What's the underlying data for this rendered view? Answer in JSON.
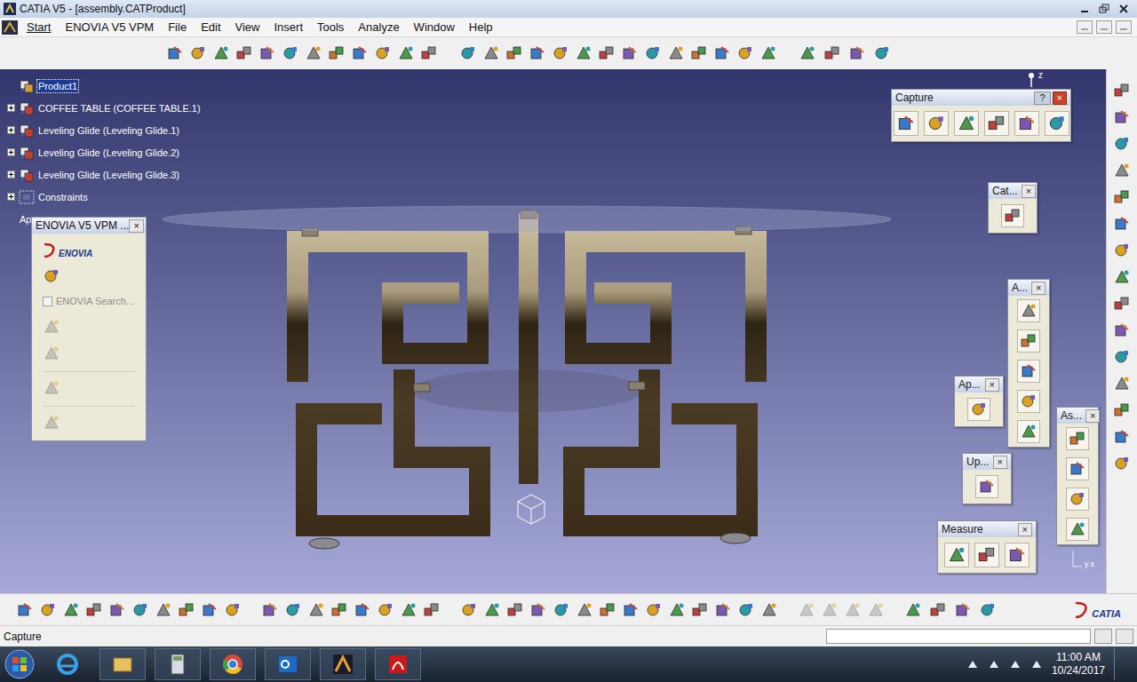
{
  "window": {
    "title": "CATIA V5 - [assembly.CATProduct]"
  },
  "menu": [
    "Start",
    "ENOVIA V5 VPM",
    "File",
    "Edit",
    "View",
    "Insert",
    "Tools",
    "Analyze",
    "Window",
    "Help"
  ],
  "tree": {
    "items": [
      {
        "label": "Product1",
        "selected": true,
        "expandable": false,
        "kind": "root"
      },
      {
        "label": "COFFEE TABLE (COFFEE TABLE.1)",
        "selected": false,
        "expandable": true,
        "kind": "part"
      },
      {
        "label": "Leveling Glide (Leveling Glide.1)",
        "selected": false,
        "expandable": true,
        "kind": "part"
      },
      {
        "label": "Leveling Glide (Leveling Glide.2)",
        "selected": false,
        "expandable": true,
        "kind": "part"
      },
      {
        "label": "Leveling Glide (Leveling Glide.3)",
        "selected": false,
        "expandable": true,
        "kind": "part"
      },
      {
        "label": "Constraints",
        "selected": false,
        "expandable": true,
        "kind": "constraints"
      },
      {
        "label": "Ap",
        "selected": false,
        "expandable": false,
        "kind": "applications"
      }
    ]
  },
  "compass": {
    "label": "z"
  },
  "axes": {
    "labels": [
      "y",
      "x"
    ]
  },
  "enovia_panel": {
    "title": "ENOVIA V5 VPM ...",
    "close": "×",
    "logo": "ENOVIA",
    "search": {
      "label": "ENOVIA Search...",
      "checked": false,
      "disabled": true
    }
  },
  "floating_panels": [
    {
      "kind": "capture",
      "title": "Capture",
      "help": "?",
      "close": "×"
    },
    {
      "kind": "cat",
      "title": "Cat...",
      "help": "",
      "close": "×"
    },
    {
      "kind": "a",
      "title": "A...",
      "help": "",
      "close": "×"
    },
    {
      "kind": "ap",
      "title": "Ap...",
      "help": "",
      "close": "×"
    },
    {
      "kind": "up",
      "title": "Up...",
      "help": "",
      "close": "×"
    },
    {
      "kind": "as",
      "title": "As...",
      "help": "",
      "close": "×"
    },
    {
      "kind": "measure",
      "title": "Measure",
      "help": "",
      "close": "×"
    }
  ],
  "status_bar": {
    "text": "Capture"
  },
  "brand": "CATIA",
  "taskbar": {
    "time": "11:00 AM",
    "date": "10/24/2017"
  }
}
